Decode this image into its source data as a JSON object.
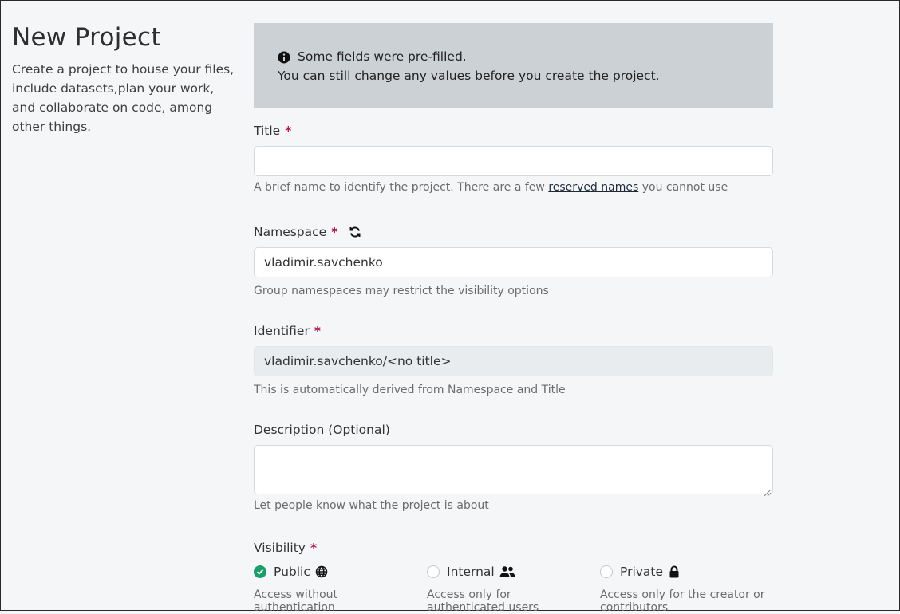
{
  "intro": {
    "title": "New Project",
    "description": "Create a project to house your files, include datasets,plan your work, and collaborate on code, among other things."
  },
  "alert": {
    "icon": "info-circle-icon",
    "line1": "Some fields were pre-filled.",
    "line2": "You can still change any values before you create the project."
  },
  "fields": {
    "title": {
      "label": "Title",
      "required_mark": "*",
      "value": "",
      "help_prefix": "A brief name to identify the project. There are a few ",
      "help_link": "reserved names",
      "help_suffix": " you cannot use"
    },
    "namespace": {
      "label": "Namespace",
      "required_mark": "*",
      "refresh_icon": "refresh-icon",
      "value": "vladimir.savchenko",
      "help": "Group namespaces may restrict the visibility options"
    },
    "identifier": {
      "label": "Identifier",
      "required_mark": "*",
      "value": "vladimir.savchenko/<no title>",
      "help": "This is automatically derived from Namespace and Title"
    },
    "description": {
      "label": "Description (Optional)",
      "value": "",
      "help": "Let people know what the project is about"
    },
    "visibility": {
      "label": "Visibility",
      "required_mark": "*",
      "options": [
        {
          "label": "Public",
          "icon": "globe-icon",
          "help": "Access without authentication",
          "checked": true
        },
        {
          "label": "Internal",
          "icon": "users-icon",
          "help": "Access only for authenticated users",
          "checked": false
        },
        {
          "label": "Private",
          "icon": "lock-icon",
          "help": "Access only for the creator or contributors",
          "checked": false
        }
      ]
    }
  },
  "colors": {
    "required": "#b80d4f",
    "alert_bg": "#ccd1d6",
    "radio_checked": "#1a9e6a"
  }
}
